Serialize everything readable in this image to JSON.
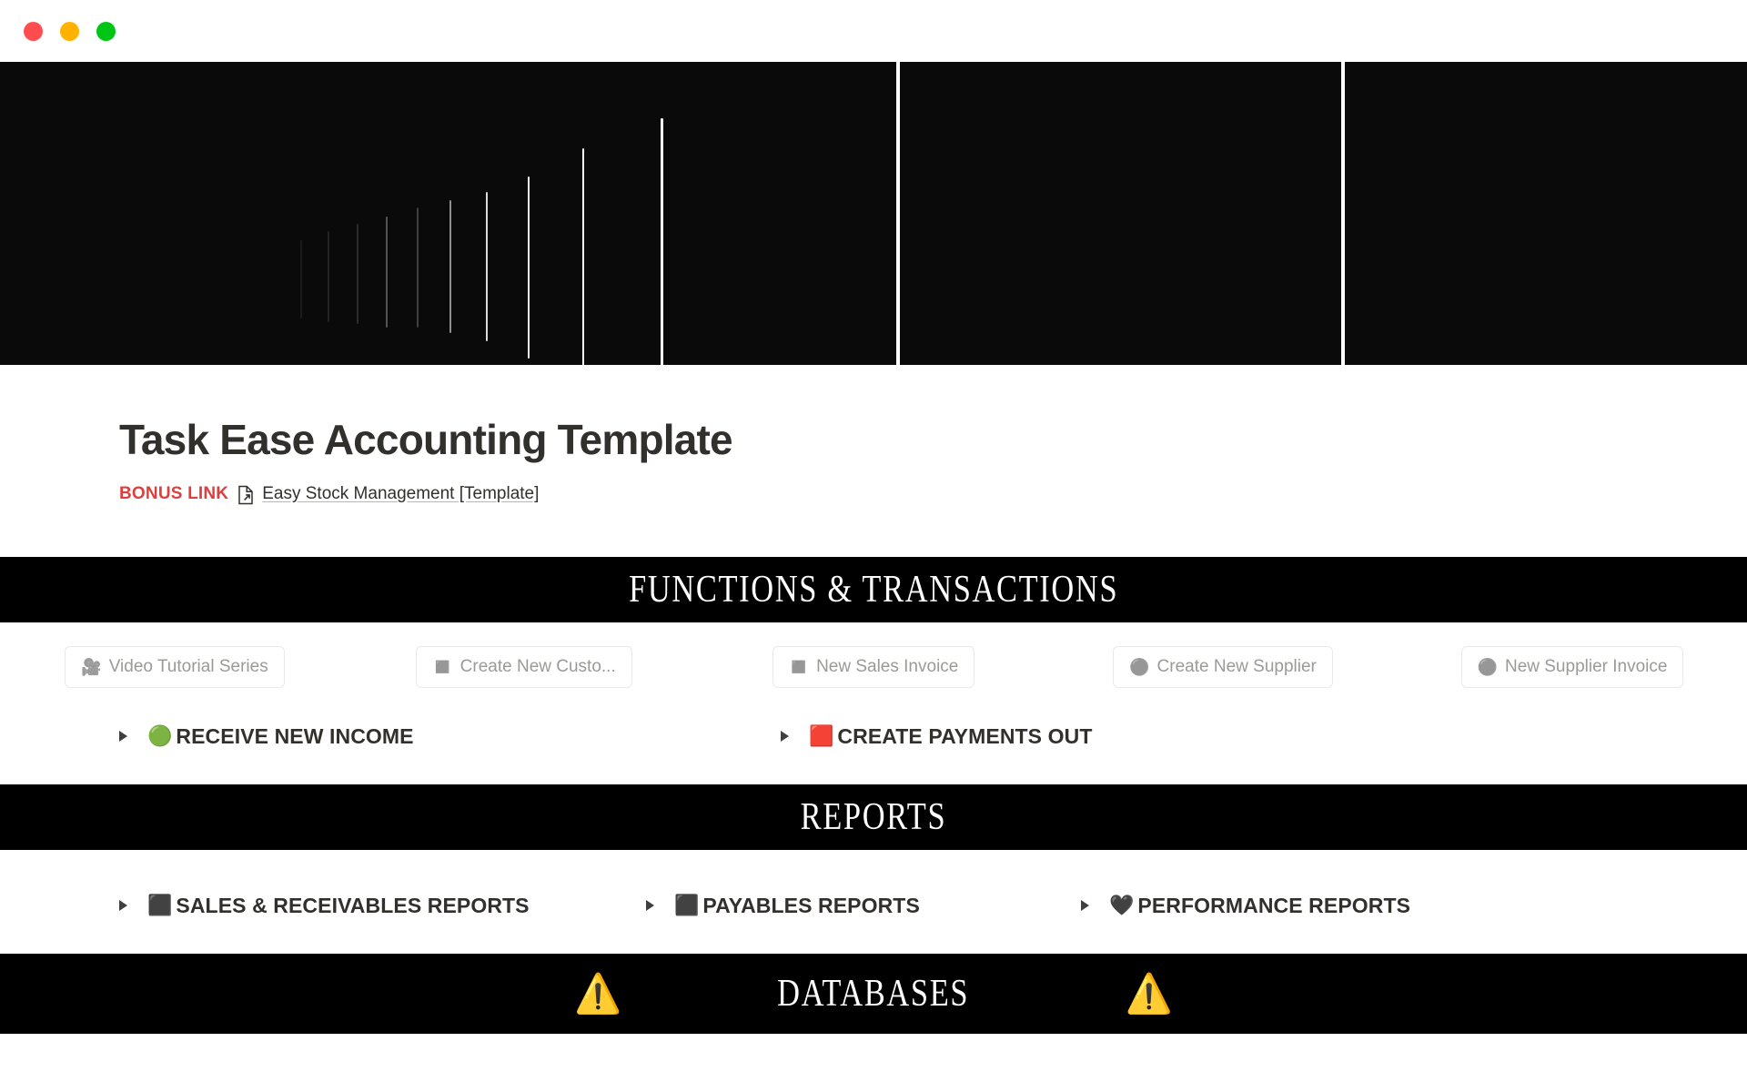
{
  "window": {
    "traffic_lights": [
      {
        "name": "close",
        "color": "#ff4d4f"
      },
      {
        "name": "minimize",
        "color": "#ffb300"
      },
      {
        "name": "maximize",
        "color": "#00c514"
      }
    ]
  },
  "cover": {
    "panels": [
      {
        "name": "cover-image-main",
        "background": "#0a0a0a"
      },
      {
        "name": "cover-image-mid",
        "background": "#0a0a0a"
      },
      {
        "name": "cover-image-right",
        "background": "#0a0a0a"
      }
    ]
  },
  "header": {
    "title": "Task Ease Accounting Template",
    "bonus": {
      "label": "BONUS LINK",
      "label_color": "#e03e3e",
      "icon": "document-link-icon",
      "link_text": "Easy Stock Management [Template]"
    }
  },
  "sections": {
    "functions": {
      "banner_title": "FUNCTIONS & TRANSACTIONS",
      "buttons": [
        {
          "icon": "movie-camera-icon",
          "emoji": "🎥",
          "label": "Video Tutorial Series"
        },
        {
          "icon": "white-square-icon",
          "emoji": "◼️",
          "label": "Create New Custo..."
        },
        {
          "icon": "white-square-icon",
          "emoji": "◼️",
          "label": "New Sales Invoice"
        },
        {
          "icon": "grey-circle-icon",
          "emoji": "⚫",
          "label": "Create New Supplier"
        },
        {
          "icon": "grey-circle-icon",
          "emoji": "⚫",
          "label": "New Supplier Invoice"
        }
      ],
      "toggles": [
        {
          "icon": "green-circle-icon",
          "emoji": "🟢",
          "label": "RECEIVE NEW INCOME"
        },
        {
          "icon": "red-square-icon",
          "emoji": "🟥",
          "label": "CREATE PAYMENTS OUT"
        }
      ]
    },
    "reports": {
      "banner_title": "REPORTS",
      "toggles": [
        {
          "icon": "black-square-icon",
          "emoji": "⬛",
          "label": "SALES & RECEIVABLES REPORTS"
        },
        {
          "icon": "black-square-icon",
          "emoji": "⬛",
          "label": "PAYABLES REPORTS"
        },
        {
          "icon": "black-heart-icon",
          "emoji": "🖤",
          "label": "PERFORMANCE REPORTS"
        }
      ]
    },
    "databases": {
      "banner_title": "DATABASES",
      "left_icon": "warning-triangle-icon",
      "left_emoji": "⚠️",
      "right_icon": "warning-triangle-icon",
      "right_emoji": "⚠️"
    }
  },
  "colors": {
    "banner_background": "#000000",
    "banner_text": "#ffffff",
    "page_text": "#32302c",
    "muted_text": "#9b9a97",
    "accent_red": "#e03e3e"
  }
}
